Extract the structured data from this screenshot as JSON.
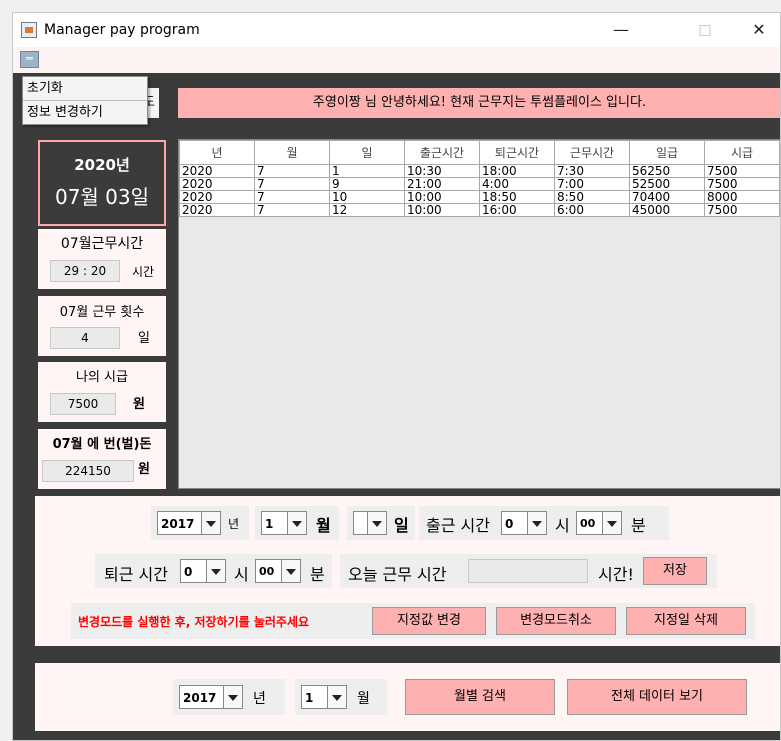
{
  "window": {
    "title": "Manager pay program",
    "minimize": "—",
    "maximize": "□",
    "close": "✕"
  },
  "menu": {
    "button_glyph": "═",
    "items": [
      "초기화",
      "정보 변경하기"
    ]
  },
  "greeting": "주영이짱  님 안녕하세요! 현재 근무지는   투썸플레이스 입니다.",
  "hidden_button_fragment": "도",
  "current_date": {
    "year": "2020년",
    "month_day": "07월 03일"
  },
  "stats": {
    "work_time": {
      "label": "07월근무시간",
      "value": "29 : 20",
      "unit": "시간"
    },
    "work_count": {
      "label": "07월 근무 횟수",
      "value": "4",
      "unit": "일"
    },
    "hourly_wage": {
      "label": "나의 시급",
      "value": "7500",
      "unit": "원"
    },
    "earned": {
      "label": "07월  에 번(벌)돈",
      "value": "224150",
      "unit": "원"
    }
  },
  "table": {
    "columns": [
      "년",
      "월",
      "일",
      "출근시간",
      "퇴근시간",
      "근무시간",
      "일급",
      "시급"
    ],
    "rows": [
      [
        "2020",
        "7",
        "1",
        "10:30",
        "18:00",
        "7:30",
        "56250",
        "7500"
      ],
      [
        "2020",
        "7",
        "9",
        "21:00",
        "4:00",
        "7:00",
        "52500",
        "7500"
      ],
      [
        "2020",
        "7",
        "10",
        "10:00",
        "18:50",
        "8:50",
        "70400",
        "8000"
      ],
      [
        "2020",
        "7",
        "12",
        "10:00",
        "16:00",
        "6:00",
        "45000",
        "7500"
      ]
    ]
  },
  "input": {
    "year_value": "2017",
    "year_label": "년",
    "month_value": "1",
    "month_label": "월",
    "day_value": "",
    "day_label": "일",
    "start_label": "출근 시간",
    "start_hour": "0",
    "hour_label": "시",
    "start_min": "00",
    "min_label": "분",
    "end_label": "퇴근 시간",
    "end_hour": "0",
    "end_hour_label": "시",
    "end_min": "00",
    "end_min_label": "분",
    "today_label": "오늘 근무 시간",
    "today_value": "",
    "hours_label": "시간!",
    "save_button": "저장",
    "notice": "변경모드를 실행한 후, 저장하기를 눌러주세요",
    "edit_button": "지정값 변경",
    "cancel_button": "변경모드취소",
    "delete_button": "지정일 삭제"
  },
  "search": {
    "year_value": "2017",
    "year_label": "년",
    "month_value": "1",
    "month_label": "월",
    "monthly_button": "월별 검색",
    "all_button": "전체 데이터 보기"
  },
  "colors": {
    "accent_pink": "#ffb0b0",
    "dark_bg": "#3b3b3b",
    "panel_bg": "#fff5f5",
    "notice_red": "#ff0000"
  }
}
